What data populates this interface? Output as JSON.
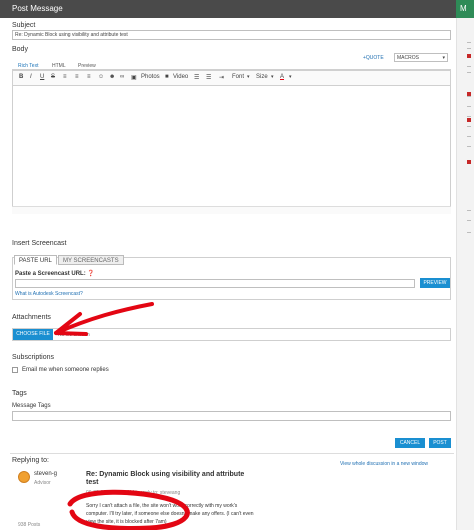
{
  "header": {
    "title": "Post Message",
    "right_tab": "M"
  },
  "subject": {
    "label": "Subject",
    "value": "Re: Dynamic Block using visibility and attribute test"
  },
  "body": {
    "label": "Body",
    "quote_label": "+QUOTE",
    "macros_value": "MACROS",
    "tabs": [
      "Rich Text",
      "HTML",
      "Preview"
    ],
    "toolbar": {
      "photos": "Photos",
      "video": "Video",
      "font": "Font",
      "size": "Size",
      "color": "A"
    }
  },
  "screencast": {
    "heading": "Insert Screencast",
    "tabs": [
      "PASTE URL",
      "MY SCREENCASTS"
    ],
    "paste_label": "Paste a Screencast URL:",
    "preview": "PREVIEW",
    "what_is": "What is Autodesk Screencast?"
  },
  "attachments": {
    "heading": "Attachments",
    "choose_file": "CHOOSE FILE",
    "no_file": "No file chosen"
  },
  "subscriptions": {
    "heading": "Subscriptions",
    "email_label": "Email me when someone replies"
  },
  "tags": {
    "heading": "Tags",
    "message_tags": "Message Tags"
  },
  "actions": {
    "cancel": "CANCEL",
    "post": "POST"
  },
  "replying": {
    "label": "Replying to:",
    "username": "steven-g",
    "role": "Advisor",
    "posts": "938 Posts",
    "title": "Re: Dynamic Block using visibility and attribute test",
    "meta": "06-23-2017 08:55 AM in reply to: steveang",
    "view_whole": "View whole discussion in a new window",
    "body_line1": "Sorry I can't attach a file, the site won't work correctly with my work's",
    "body_line2": "computer. I'll try later, if someone else doesn't make any offers. (I can't even",
    "body_line3": "view the site, it is blocked after 7am)"
  },
  "colors": {
    "header": "#4a4a4a",
    "accent_blue": "#1a8fd1",
    "annotation_red": "#e30613",
    "right_green": "#2e8b57"
  }
}
